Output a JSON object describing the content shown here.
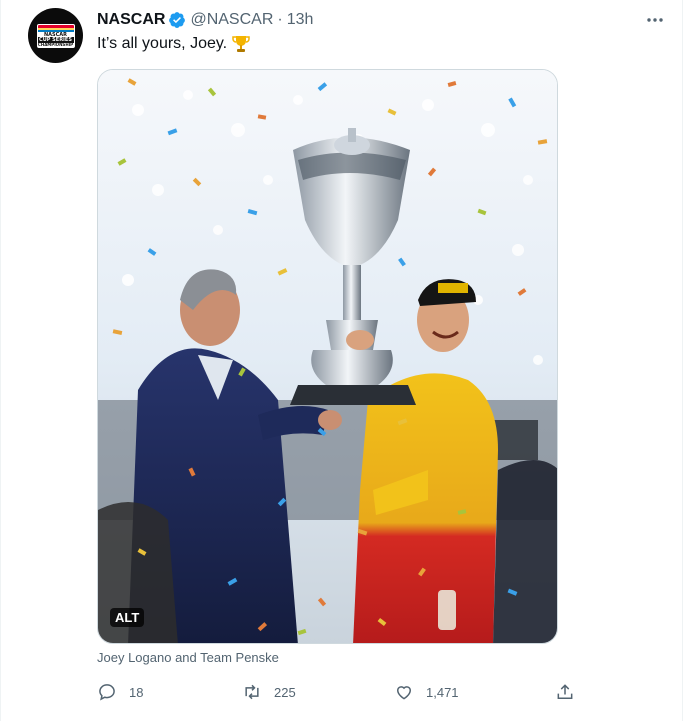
{
  "account": {
    "name": "NASCAR",
    "handle": "@NASCAR",
    "separator": "·",
    "time": "13h",
    "avatar_logo_lines": [
      "NASCAR",
      "CUP SERIES",
      "CHAMPIONSHIP"
    ]
  },
  "tweet": {
    "text": "It’s all yours, Joey.",
    "emoji": "trophy"
  },
  "media": {
    "alt_label": "ALT",
    "caption": "Joey Logano and Team Penske"
  },
  "actions": {
    "replies": "18",
    "retweets": "225",
    "likes": "1,471"
  },
  "colors": {
    "text": "#0f1419",
    "secondary": "#536471",
    "verified": "#1d9bf0",
    "border": "#eff3f4"
  },
  "icons": [
    "verified-badge-icon",
    "more-icon",
    "trophy-icon",
    "reply-icon",
    "retweet-icon",
    "like-icon",
    "share-icon"
  ]
}
